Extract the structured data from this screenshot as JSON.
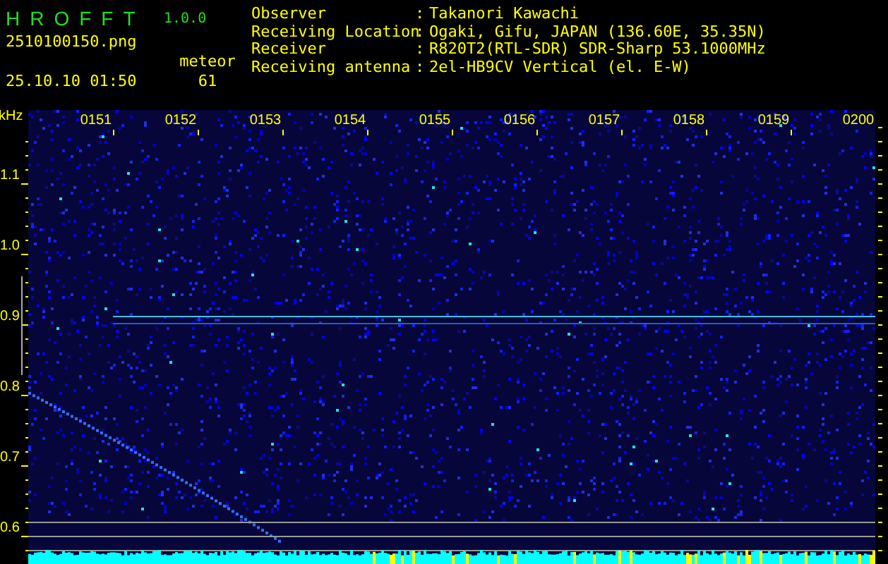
{
  "app": {
    "name": "HROFFT",
    "version": "1.0.0",
    "file": "2510100150.png",
    "timestamp": "25.10.10 01:50",
    "meteor_label": "meteor",
    "meteor_count": "61"
  },
  "station": [
    {
      "label": "Observer",
      "separator": ":",
      "value": "Takanori Kawachi"
    },
    {
      "label": "Receiving Location",
      "separator": ":",
      "value": "Ogaki, Gifu, JAPAN (136.60E, 35.35N)"
    },
    {
      "label": "Receiver",
      "separator": ":",
      "value": "R820T2(RTL-SDR) SDR-Sharp 53.1000MHz"
    },
    {
      "label": "Receiving antenna",
      "separator": ":",
      "value": "2el-HB9CV Vertical (el. E-W)"
    }
  ],
  "spectrogram": {
    "unit": "kHz",
    "time_ticks": [
      "0151",
      "0152",
      "0153",
      "0154",
      "0155",
      "0156",
      "0157",
      "0158",
      "0159",
      "0200"
    ],
    "freq_ticks": [
      "1.1",
      "1.0",
      "0.9",
      "0.8",
      "0.7",
      "0.6"
    ]
  }
}
